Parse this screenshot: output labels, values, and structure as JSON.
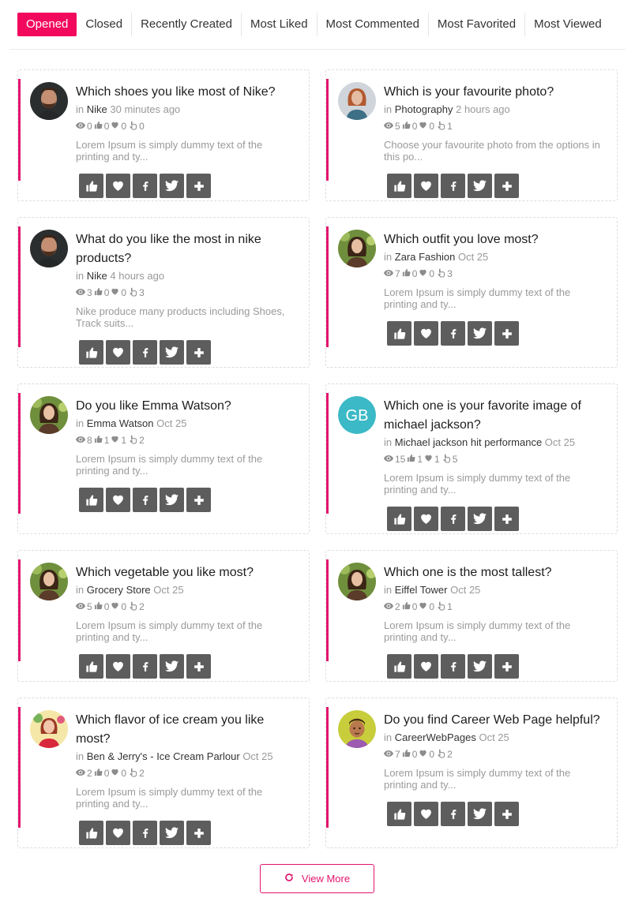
{
  "tabs": [
    "Opened",
    "Closed",
    "Recently Created",
    "Most Liked",
    "Most Commented",
    "Most Favorited",
    "Most Viewed"
  ],
  "active_tab": "Opened",
  "colors": {
    "accent": "#e2156e",
    "active_tab": "#f2095d",
    "action_button": "#5d5d5d"
  },
  "cards": [
    {
      "title": "Which shoes you like most of Nike?",
      "in": "in",
      "category": "Nike",
      "time": "30 minutes ago",
      "views": "0",
      "likes": "0",
      "favorites": "0",
      "comments": "0",
      "excerpt": "Lorem Ipsum is simply dummy text of the printing and ty...",
      "avatar": "man-beard-photo"
    },
    {
      "title": "Which is your favourite photo?",
      "in": "in",
      "category": "Photography",
      "time": "2 hours ago",
      "views": "5",
      "likes": "0",
      "favorites": "0",
      "comments": "1",
      "excerpt": "Choose your favourite photo from the options in this po...",
      "avatar": "woman-red-hair-photo"
    },
    {
      "title": "What do you like the most in nike products?",
      "in": "in",
      "category": "Nike",
      "time": "4 hours ago",
      "views": "3",
      "likes": "0",
      "favorites": "0",
      "comments": "3",
      "excerpt": "Nike produce many products including Shoes, Track suits...",
      "avatar": "man-beard-photo"
    },
    {
      "title": "Which outfit you love most?",
      "in": "in",
      "category": "Zara Fashion",
      "time": "Oct 25",
      "views": "7",
      "likes": "0",
      "favorites": "0",
      "comments": "3",
      "excerpt": "Lorem Ipsum is simply dummy text of the printing and ty...",
      "avatar": "woman-photo"
    },
    {
      "title": "Do you like Emma Watson?",
      "in": "in",
      "category": "Emma Watson",
      "time": "Oct 25",
      "views": "8",
      "likes": "1",
      "favorites": "1",
      "comments": "2",
      "excerpt": "Lorem Ipsum is simply dummy text of the printing and ty...",
      "avatar": "woman-photo"
    },
    {
      "title": "Which one is your favorite image of michael jackson?",
      "in": "in",
      "category": "Michael jackson hit performance",
      "time": "Oct 25",
      "views": "15",
      "likes": "1",
      "favorites": "1",
      "comments": "5",
      "excerpt": "Lorem Ipsum is simply dummy text of the printing and ty...",
      "avatar": "initials",
      "initials": "GB"
    },
    {
      "title": "Which vegetable you like most?",
      "in": "in",
      "category": "Grocery Store",
      "time": "Oct 25",
      "views": "5",
      "likes": "0",
      "favorites": "0",
      "comments": "2",
      "excerpt": "Lorem Ipsum is simply dummy text of the printing and ty...",
      "avatar": "woman-photo"
    },
    {
      "title": "Which one is the most tallest?",
      "in": "in",
      "category": "Eiffel Tower",
      "time": "Oct 25",
      "views": "2",
      "likes": "0",
      "favorites": "0",
      "comments": "1",
      "excerpt": "Lorem Ipsum is simply dummy text of the printing and ty...",
      "avatar": "woman-photo"
    },
    {
      "title": "Which flavor of ice cream you like most?",
      "in": "in",
      "category": "Ben & Jerry's - Ice Cream Parlour",
      "time": "Oct 25",
      "views": "2",
      "likes": "0",
      "favorites": "0",
      "comments": "2",
      "excerpt": "Lorem Ipsum is simply dummy text of the printing and ty...",
      "avatar": "woman-red-dress-photo"
    },
    {
      "title": "Do you find Career Web Page helpful?",
      "in": "in",
      "category": "CareerWebPages",
      "time": "Oct 25",
      "views": "7",
      "likes": "0",
      "favorites": "0",
      "comments": "2",
      "excerpt": "Lorem Ipsum is simply dummy text of the printing and ty...",
      "avatar": "cartoon-boy"
    }
  ],
  "action_icons": [
    "thumbs-up-icon",
    "heart-icon",
    "facebook-icon",
    "twitter-icon",
    "plus-icon"
  ],
  "view_more": {
    "label": "View More",
    "icon": "refresh-icon"
  }
}
